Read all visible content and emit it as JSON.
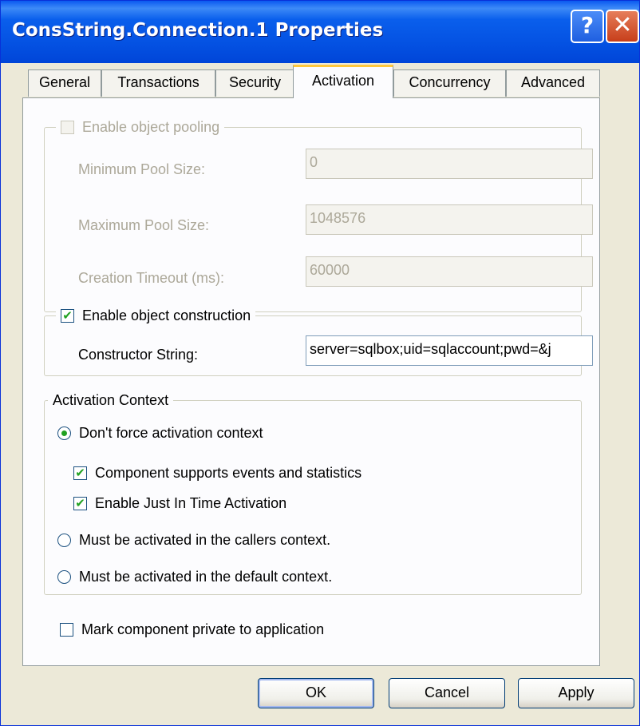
{
  "window": {
    "title": "ConsString.Connection.1 Properties",
    "help_glyph": "?",
    "close_glyph": "✕"
  },
  "tabs": [
    {
      "label": "General"
    },
    {
      "label": "Transactions"
    },
    {
      "label": "Security"
    },
    {
      "label": "Activation",
      "active": true
    },
    {
      "label": "Concurrency"
    },
    {
      "label": "Advanced"
    }
  ],
  "pooling": {
    "label": "Enable object pooling",
    "checked": false,
    "enabled": false,
    "min_label": "Minimum Pool Size:",
    "min_value": "0",
    "max_label": "Maximum Pool Size:",
    "max_value": "1048576",
    "timeout_label": "Creation Timeout (ms):",
    "timeout_value": "60000"
  },
  "construction": {
    "label": "Enable object construction",
    "checked": true,
    "ctor_label": "Constructor String:",
    "ctor_value": "server=sqlbox;uid=sqlaccount;pwd=&j"
  },
  "context": {
    "legend": "Activation Context",
    "radio_dont_force": "Don't force activation context",
    "events_label": "Component supports events and statistics",
    "jit_label": "Enable Just In Time Activation",
    "radio_callers": "Must be activated in the callers context.",
    "radio_default": "Must be activated in the default context."
  },
  "private": {
    "label": "Mark component private to application",
    "checked": false
  },
  "buttons": {
    "ok": "OK",
    "cancel": "Cancel",
    "apply": "Apply"
  },
  "glyphs": {
    "check": "✔"
  },
  "colors": {
    "title_blue": "#0451e2",
    "check_green": "#21a121",
    "dialog_bg": "#ece9d8",
    "tab_accent": "#ffc83c"
  }
}
